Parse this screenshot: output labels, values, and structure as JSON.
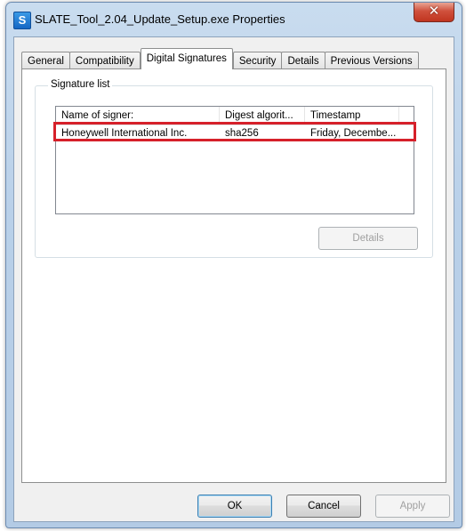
{
  "window": {
    "title": "SLATE_Tool_2.04_Update_Setup.exe Properties",
    "icon_letter": "S",
    "close_label": "✕"
  },
  "tabs": [
    {
      "label": "General",
      "active": false
    },
    {
      "label": "Compatibility",
      "active": false
    },
    {
      "label": "Digital Signatures",
      "active": true
    },
    {
      "label": "Security",
      "active": false
    },
    {
      "label": "Details",
      "active": false
    },
    {
      "label": "Previous Versions",
      "active": false
    }
  ],
  "signature_list": {
    "legend": "Signature list",
    "columns": [
      "Name of signer:",
      "Digest algorit...",
      "Timestamp"
    ],
    "rows": [
      [
        "Honeywell International Inc.",
        "sha256",
        "Friday, Decembe..."
      ]
    ],
    "highlight_color": "#d6202a",
    "details_label": "Details"
  },
  "footer": {
    "ok_label": "OK",
    "cancel_label": "Cancel",
    "apply_label": "Apply"
  }
}
